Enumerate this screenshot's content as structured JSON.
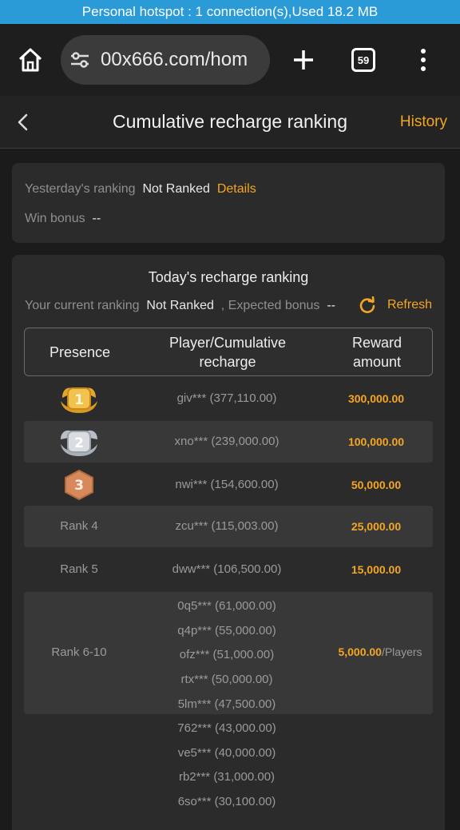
{
  "status_bar": {
    "text": "Personal hotspot : 1 connection(s),Used  18.2 MB"
  },
  "browser": {
    "url": "00x666.com/hom",
    "tab_count": "59"
  },
  "header": {
    "title": "Cumulative recharge ranking",
    "history": "History"
  },
  "yesterday": {
    "label": "Yesterday's ranking",
    "value": "Not Ranked",
    "details": "Details",
    "bonus_label": "Win bonus",
    "bonus_value": "--"
  },
  "today": {
    "title": "Today's recharge ranking",
    "current_label": "Your current ranking",
    "current_value": "Not Ranked",
    "expected_label": ", Expected bonus",
    "expected_value": "--",
    "refresh": "Refresh"
  },
  "table": {
    "col1": "Presence",
    "col2_line1": "Player/Cumulative",
    "col2_line2": "recharge",
    "col3_line1": "Reward",
    "col3_line2": "amount",
    "medals": [
      "1",
      "2",
      "3"
    ],
    "rows": [
      {
        "rank": "",
        "player": "giv*** (377,110.00)",
        "reward": "300,000.00"
      },
      {
        "rank": "",
        "player": "xno*** (239,000.00)",
        "reward": "100,000.00"
      },
      {
        "rank": "",
        "player": "nwi*** (154,600.00)",
        "reward": "50,000.00"
      },
      {
        "rank": "Rank 4",
        "player": "zcu*** (115,003.00)",
        "reward": "25,000.00"
      },
      {
        "rank": "Rank 5",
        "player": "dww*** (106,500.00)",
        "reward": "15,000.00"
      }
    ],
    "group1": {
      "rank": "Rank 6-10",
      "reward": "5,000.00",
      "per": "/Players",
      "players": [
        "0q5*** (61,000.00)",
        "q4p*** (55,000.00)",
        "ofz*** (51,000.00)",
        "rtx*** (50,000.00)",
        "5lm*** (47,500.00)"
      ]
    },
    "group2": {
      "players": [
        "762*** (43,000.00)",
        "ve5*** (40,000.00)",
        "rb2*** (31,000.00)",
        "6so*** (30,100.00)"
      ]
    }
  },
  "colors": {
    "accent": "#f5a623",
    "status_bar": "#2a9bd6",
    "gold": "#e9b83a",
    "silver": "#cfd3d8",
    "bronze": "#d2875a"
  }
}
